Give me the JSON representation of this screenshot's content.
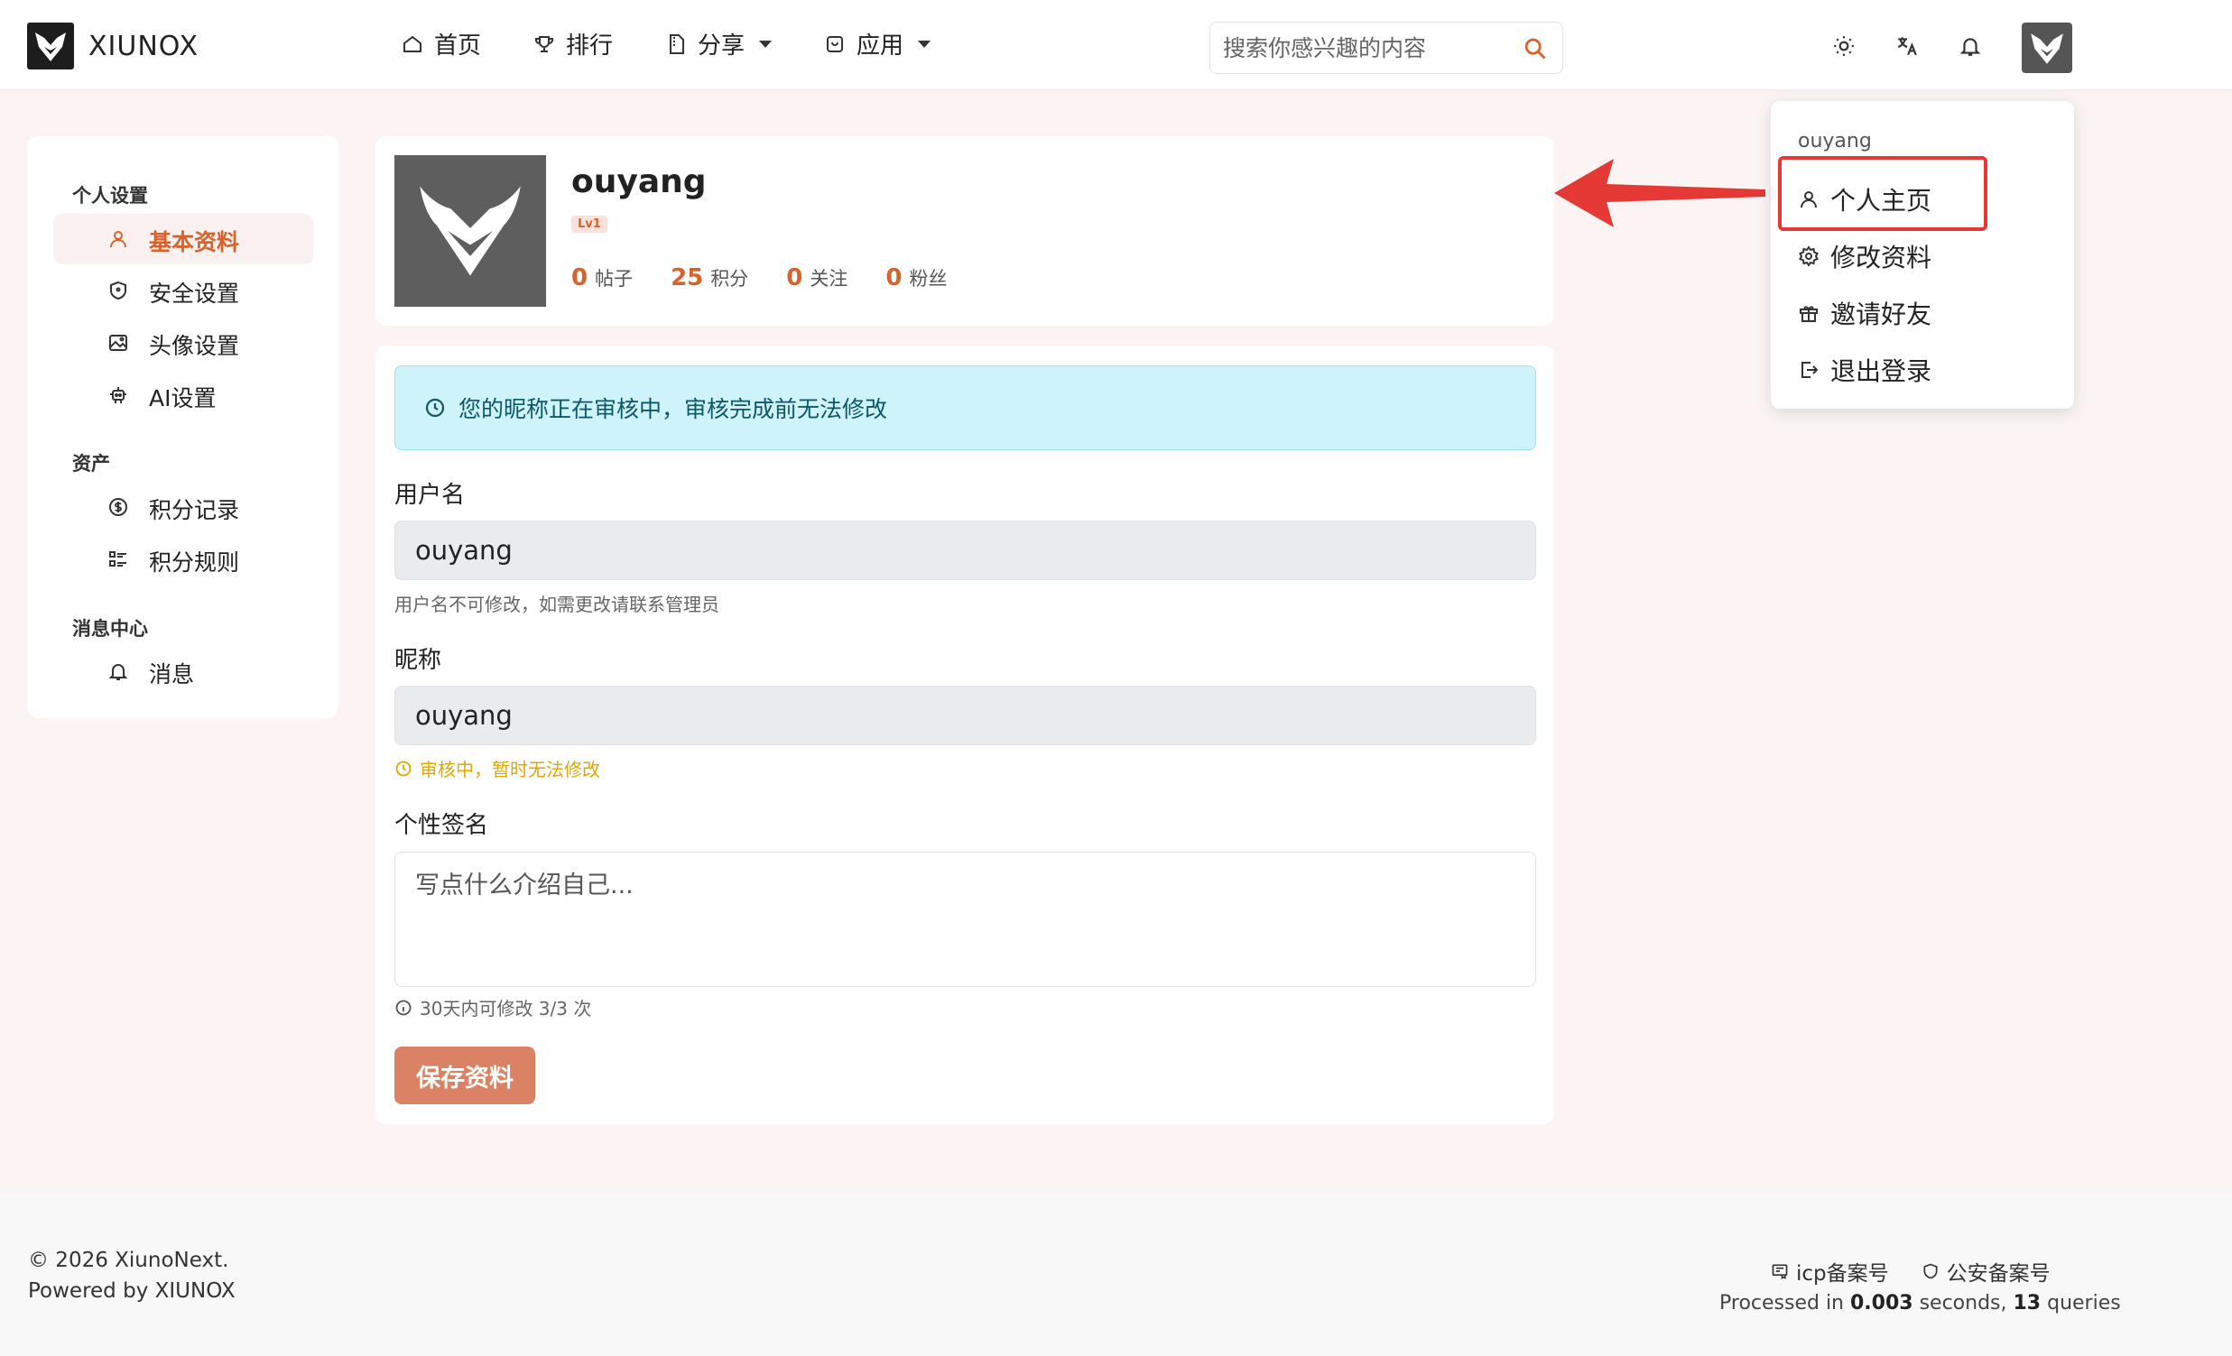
{
  "brand": {
    "name": "XIUNOX"
  },
  "nav": {
    "items": [
      {
        "label": "首页",
        "icon": "home-icon"
      },
      {
        "label": "排行",
        "icon": "trophy-icon"
      },
      {
        "label": "分享",
        "icon": "file-zip-icon",
        "dropdown": true
      },
      {
        "label": "应用",
        "icon": "app-icon",
        "dropdown": true
      }
    ]
  },
  "search": {
    "placeholder": "搜索你感兴趣的内容"
  },
  "sidebar": {
    "sections": [
      {
        "title": "个人设置",
        "items": [
          "基本资料",
          "安全设置",
          "头像设置",
          "AI设置"
        ]
      },
      {
        "title": "资产",
        "items": [
          "积分记录",
          "积分规则"
        ]
      },
      {
        "title": "消息中心",
        "items": [
          "消息"
        ]
      }
    ],
    "active": "基本资料"
  },
  "profile": {
    "name": "ouyang",
    "level": "Lv1",
    "stats": [
      {
        "num": "0",
        "label": "帖子"
      },
      {
        "num": "25",
        "label": "积分"
      },
      {
        "num": "0",
        "label": "关注"
      },
      {
        "num": "0",
        "label": "粉丝"
      }
    ]
  },
  "form": {
    "notice": "您的昵称正在审核中，审核完成前无法修改",
    "username_label": "用户名",
    "username_value": "ouyang",
    "username_help": "用户名不可修改，如需更改请联系管理员",
    "nickname_label": "昵称",
    "nickname_value": "ouyang",
    "nickname_help": "审核中，暂时无法修改",
    "signature_label": "个性签名",
    "signature_placeholder": "写点什么介绍自己...",
    "signature_help": "30天内可修改 3/3 次",
    "save_label": "保存资料"
  },
  "dropdown": {
    "username": "ouyang",
    "items": [
      "个人主页",
      "修改资料",
      "邀请好友",
      "退出登录"
    ]
  },
  "footer": {
    "copyright": "© 2026 XiunoNext.",
    "powered": "Powered by XIUNOX",
    "icp": "icp备案号",
    "police": "公安备案号",
    "proc_prefix": "Processed in ",
    "proc_seconds": "0.003",
    "proc_mid": " seconds, ",
    "proc_queries": "13",
    "proc_suffix": " queries"
  },
  "colors": {
    "accent": "#d9622a",
    "notice_bg": "#cff3fb",
    "highlight": "#e53935"
  }
}
